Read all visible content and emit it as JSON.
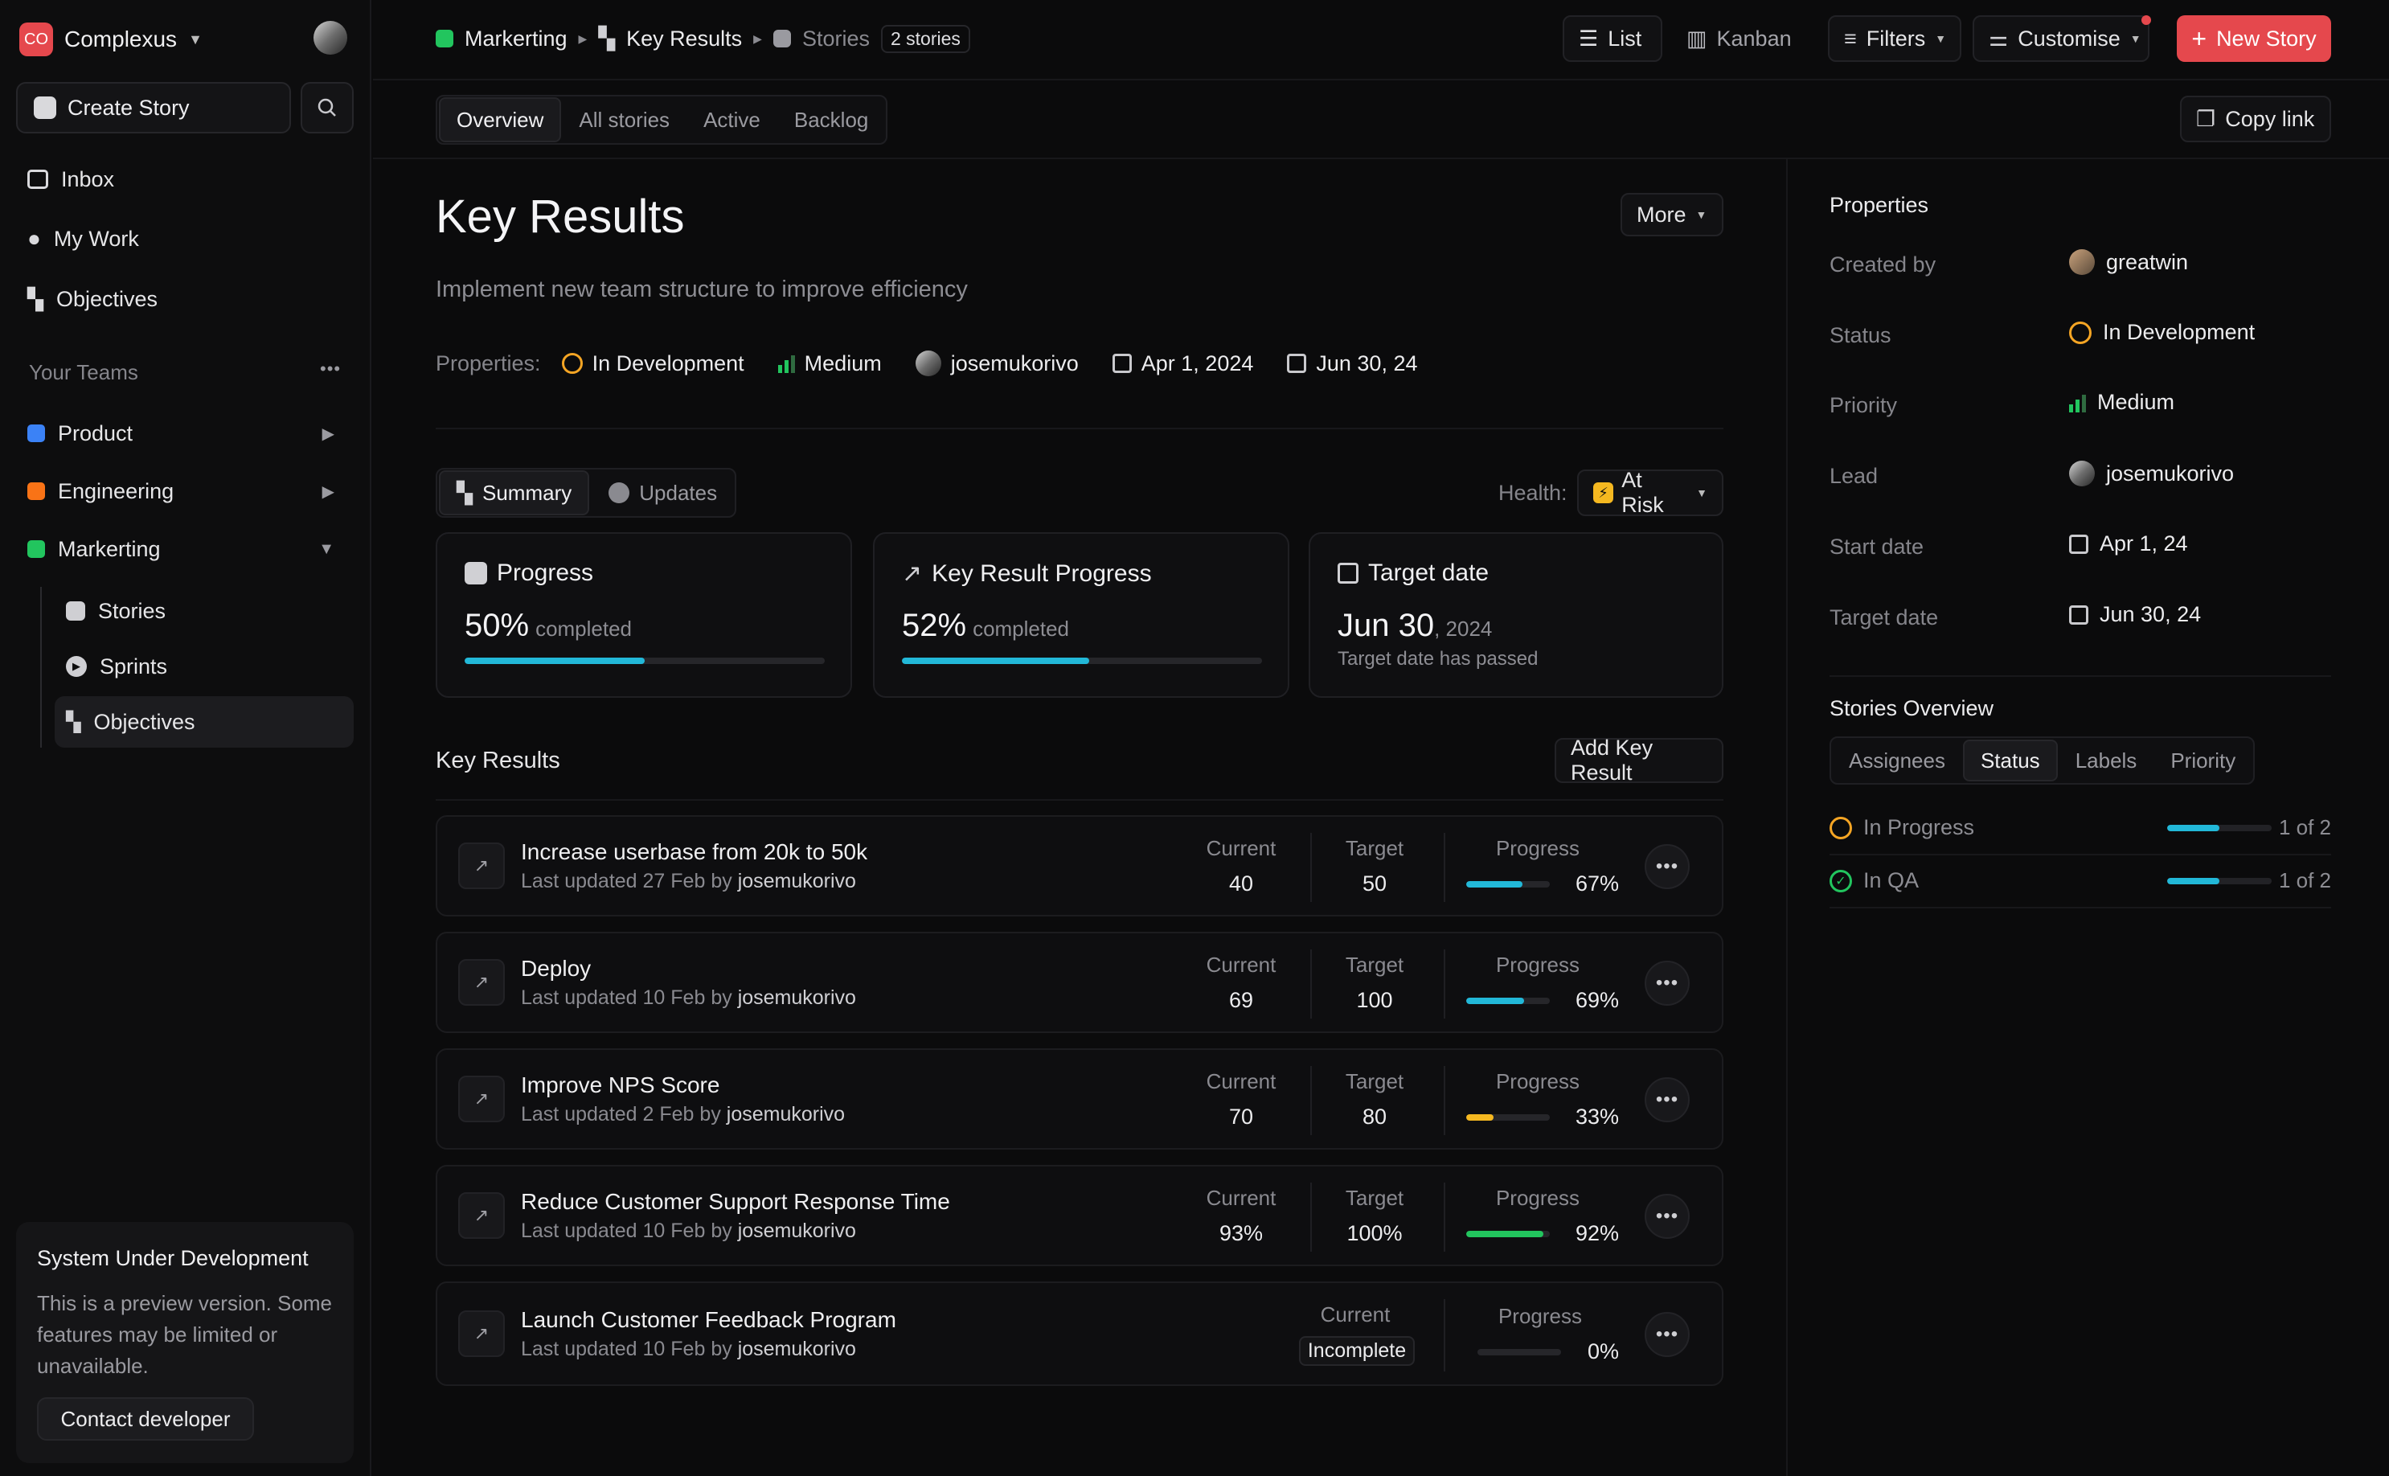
{
  "workspace": {
    "initials": "CO",
    "name": "Complexus"
  },
  "sidebar": {
    "create_story": "Create Story",
    "nav": [
      {
        "label": "Inbox"
      },
      {
        "label": "My Work"
      },
      {
        "label": "Objectives"
      }
    ],
    "teams_heading": "Your Teams",
    "teams": [
      {
        "label": "Product",
        "color": "#3b82f6"
      },
      {
        "label": "Engineering",
        "color": "#f97316"
      },
      {
        "label": "Markerting",
        "color": "#22c55e"
      }
    ],
    "team_sub": [
      {
        "label": "Stories"
      },
      {
        "label": "Sprints"
      },
      {
        "label": "Objectives"
      }
    ],
    "notice": {
      "title": "System Under Development",
      "body": "This is a preview version. Some features may be limited or unavailable.",
      "button": "Contact developer"
    }
  },
  "breadcrumb": {
    "team": "Markerting",
    "objective": "Key Results",
    "stories": "Stories",
    "count": "2 stories"
  },
  "toolbar": {
    "list": "List",
    "kanban": "Kanban",
    "filters": "Filters",
    "customise": "Customise",
    "new_story": "New Story",
    "copy_link": "Copy link"
  },
  "tabs": [
    "Overview",
    "All stories",
    "Active",
    "Backlog"
  ],
  "objective": {
    "title": "Key Results",
    "more": "More",
    "description": "Implement new team structure to improve efficiency",
    "properties_label": "Properties:",
    "status": "In Development",
    "priority": "Medium",
    "lead": "josemukorivo",
    "start": "Apr 1, 2024",
    "end": "Jun 30, 24"
  },
  "summary_tabs": {
    "summary": "Summary",
    "updates": "Updates"
  },
  "health": {
    "label": "Health:",
    "value": "At Risk"
  },
  "cards": {
    "progress": {
      "title": "Progress",
      "value": "50%",
      "suffix": "completed",
      "fraction": 0.5
    },
    "kr_progress": {
      "title": "Key Result Progress",
      "value": "52%",
      "suffix": "completed",
      "fraction": 0.52
    },
    "target": {
      "title": "Target date",
      "date": "Jun 30",
      "year": ", 2024",
      "note": "Target date has passed"
    }
  },
  "key_results": {
    "heading": "Key Results",
    "add_button": "Add Key Result",
    "col_current": "Current",
    "col_target": "Target",
    "col_progress": "Progress",
    "updated_prefix": "Last updated",
    "by": "by",
    "rows": [
      {
        "title": "Increase userbase from 20k to 50k",
        "date": "27 Feb",
        "user": "josemukorivo",
        "current": "40",
        "target": "50",
        "progress": "67%",
        "fraction": 0.67,
        "color": "#22b8d8"
      },
      {
        "title": "Deploy",
        "date": "10 Feb",
        "user": "josemukorivo",
        "current": "69",
        "target": "100",
        "progress": "69%",
        "fraction": 0.69,
        "color": "#22b8d8"
      },
      {
        "title": "Improve NPS Score",
        "date": "2 Feb",
        "user": "josemukorivo",
        "current": "70",
        "target": "80",
        "progress": "33%",
        "fraction": 0.33,
        "color": "#f5b820"
      },
      {
        "title": "Reduce Customer Support Response Time",
        "date": "10 Feb",
        "user": "josemukorivo",
        "current": "93%",
        "target": "100%",
        "progress": "92%",
        "fraction": 0.92,
        "color": "#22c55e"
      },
      {
        "title": "Launch Customer Feedback Program",
        "date": "10 Feb",
        "user": "josemukorivo",
        "current": "Incomplete",
        "target": "",
        "progress": "0%",
        "fraction": 0,
        "color": "#22b8d8"
      }
    ]
  },
  "properties_panel": {
    "heading": "Properties",
    "created_by_label": "Created by",
    "created_by": "greatwin",
    "status_label": "Status",
    "status": "In Development",
    "priority_label": "Priority",
    "priority": "Medium",
    "lead_label": "Lead",
    "lead": "josemukorivo",
    "start_label": "Start date",
    "start": "Apr 1, 24",
    "target_label": "Target date",
    "target": "Jun 30, 24"
  },
  "stories_overview": {
    "heading": "Stories Overview",
    "tabs": [
      "Assignees",
      "Status",
      "Labels",
      "Priority"
    ],
    "rows": [
      {
        "label": "In Progress",
        "count": "1 of 2",
        "fraction": 0.5
      },
      {
        "label": "In QA",
        "count": "1 of 2",
        "fraction": 0.5
      }
    ]
  },
  "colors": {
    "accent_red": "#e5484d",
    "cyan": "#22b8d8",
    "status_orange": "#f5a524",
    "qa_green": "#22c55e"
  }
}
